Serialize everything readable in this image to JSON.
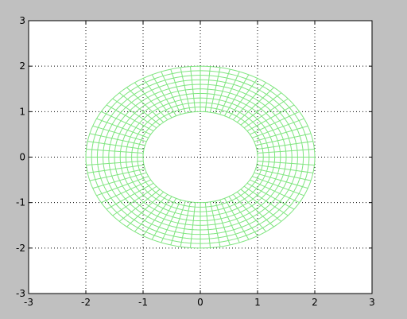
{
  "chart_data": {
    "type": "mesh",
    "title": "",
    "xlabel": "",
    "ylabel": "",
    "xlim": [
      -3,
      3
    ],
    "ylim": [
      -3,
      3
    ],
    "xticks": [
      -3,
      -2,
      -1,
      0,
      1,
      2,
      3
    ],
    "yticks": [
      -3,
      -2,
      -1,
      0,
      1,
      2,
      3
    ],
    "grid": true,
    "grid_style": "dotted",
    "series": [
      {
        "shape": "annulus",
        "center": [
          0,
          0
        ],
        "inner_radius": 1,
        "outer_radius": 2,
        "radial_divisions": 72,
        "ring_divisions": 10,
        "color": "#7fe57f"
      }
    ]
  },
  "colors": {
    "figure_background": "#c0c0c0",
    "axes_background": "#ffffff",
    "axis": "#000000",
    "grid": "#000000"
  }
}
